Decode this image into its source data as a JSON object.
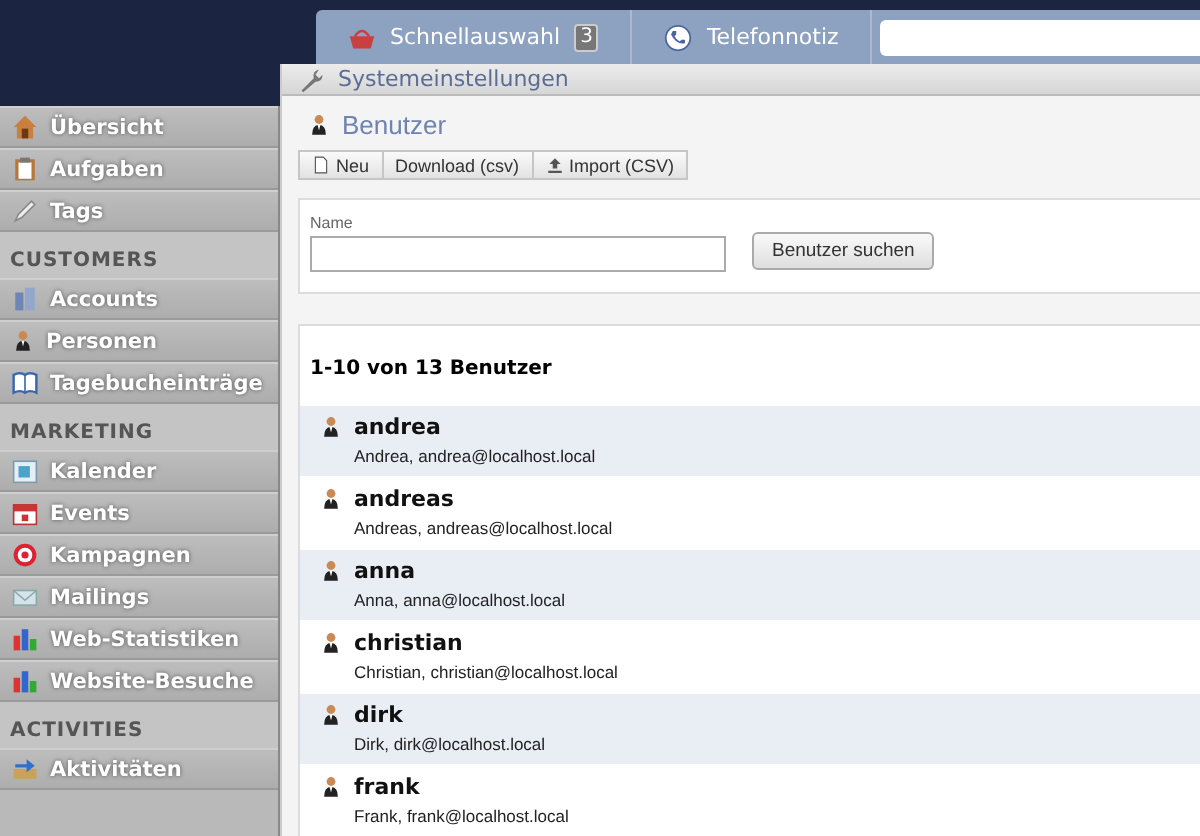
{
  "top_bar": {
    "items": [
      {
        "label": "Schnellauswahl",
        "badge": "3"
      },
      {
        "label": "Telefonnotiz"
      }
    ]
  },
  "sidebar": {
    "sections": [
      {
        "items": [
          "Übersicht",
          "Aufgaben",
          "Tags"
        ]
      },
      {
        "heading": "CUSTOMERS",
        "items": [
          "Accounts",
          "Personen",
          "Tagebucheinträge"
        ]
      },
      {
        "heading": "MARKETING",
        "items": [
          "Kalender",
          "Events",
          "Kampagnen",
          "Mailings",
          "Web-Statistiken",
          "Website-Besuche"
        ]
      },
      {
        "heading": "ACTIVITIES",
        "items": [
          "Aktivitäten"
        ]
      }
    ]
  },
  "window": {
    "title": "Systemeinstellungen"
  },
  "page_title": "Benutzer",
  "toolbar": [
    "Neu",
    "Download (csv)",
    "Import (CSV)"
  ],
  "search_form": {
    "label": "Name",
    "button": "Benutzer suchen"
  },
  "list": {
    "count": "1-10 von 13 Benutzer",
    "users": [
      {
        "name": "andrea",
        "detail": "Andrea, andrea@localhost.local"
      },
      {
        "name": "andreas",
        "detail": "Andreas, andreas@localhost.local"
      },
      {
        "name": "anna",
        "detail": "Anna, anna@localhost.local"
      },
      {
        "name": "christian",
        "detail": "Christian, christian@localhost.local"
      },
      {
        "name": "dirk",
        "detail": "Dirk, dirk@localhost.local"
      },
      {
        "name": "frank",
        "detail": "Frank, frank@localhost.local"
      }
    ]
  }
}
